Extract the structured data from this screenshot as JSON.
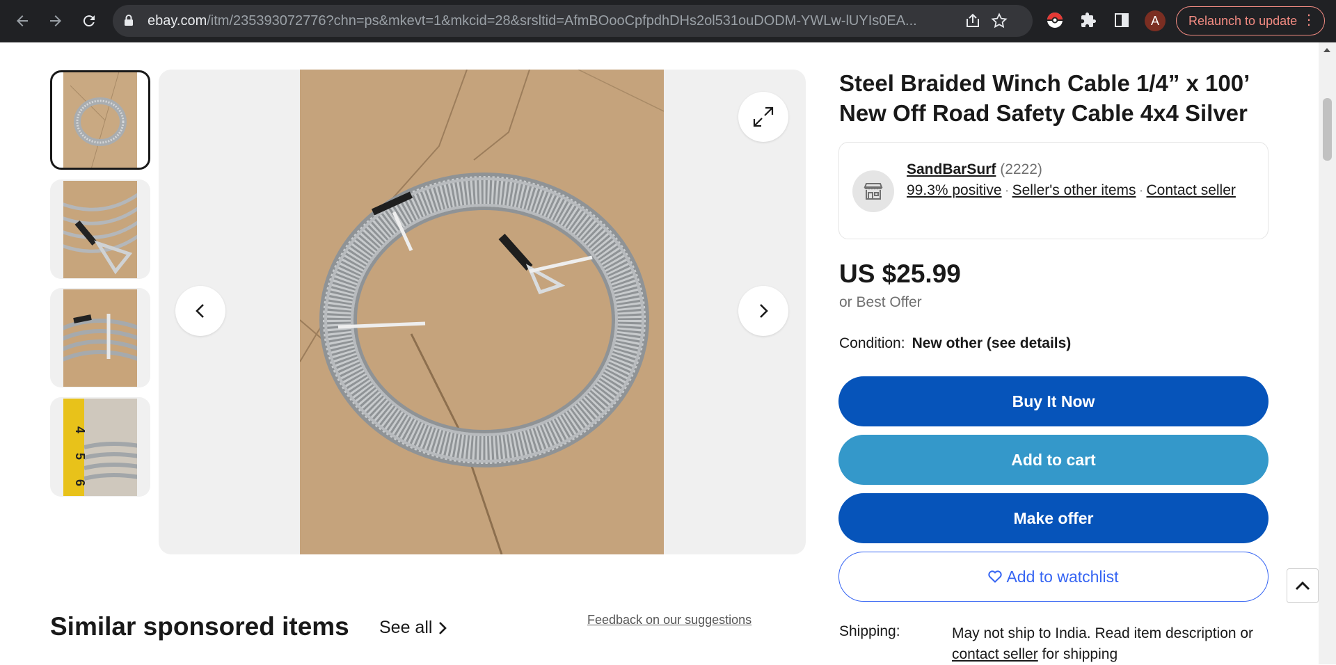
{
  "browser": {
    "url_host": "ebay.com",
    "url_path": "/itm/235393072776?chn=ps&mkevt=1&mkcid=28&srsltid=AfmBOooCpfpdhDHs2ol531ouDODM-YWLw-lUYIs0EA...",
    "profile_initial": "A",
    "relaunch_label": "Relaunch to update",
    "icons": [
      "back-icon",
      "forward-icon",
      "reload-icon",
      "lock-icon",
      "share-icon",
      "star-icon",
      "pokeball-extension-icon",
      "puzzle-extensions-icon",
      "side-panel-icon",
      "more-vert-icon"
    ]
  },
  "listing": {
    "title": "Steel Braided Winch Cable 1/4” x 100’ New Off Road Safety Cable 4x4 Silver",
    "seller": {
      "name": "SandBarSurf",
      "feedback_count": "(2222)",
      "positive": "99.3% positive",
      "other_items": "Seller's other items",
      "contact": "Contact seller"
    },
    "price": "US $25.99",
    "best_offer": "or Best Offer",
    "condition_label": "Condition:",
    "condition_value": "New other (see details)",
    "buttons": {
      "buy_now": "Buy It Now",
      "add_to_cart": "Add to cart",
      "make_offer": "Make offer",
      "watchlist": "Add to watchlist"
    },
    "shipping_label": "Shipping:",
    "shipping_text_1": "May not ship to India. Read item description or ",
    "shipping_link": "contact seller",
    "shipping_text_2": " for shipping"
  },
  "similar": {
    "heading": "Similar sponsored items",
    "see_all": "See all",
    "feedback": "Feedback on our suggestions"
  },
  "colors": {
    "primary_blue": "#0654ba",
    "cart_blue": "#3498ca",
    "link_blue": "#3665f3",
    "chrome_bg": "#202124",
    "relaunch": "#f28b82"
  }
}
